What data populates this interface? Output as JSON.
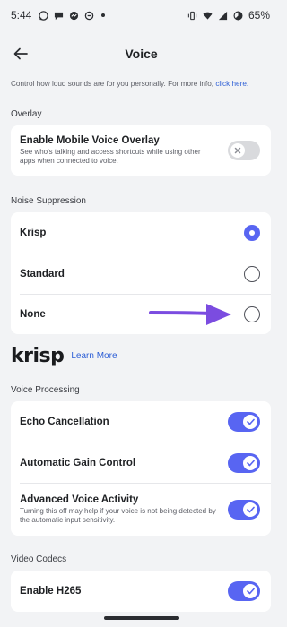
{
  "status_bar": {
    "time": "5:44",
    "battery": "65%"
  },
  "header": {
    "title": "Voice"
  },
  "info": {
    "text": "Control how loud sounds are for you personally. For more info,",
    "link": "click here."
  },
  "overlay": {
    "section_label": "Overlay",
    "title": "Enable Mobile Voice Overlay",
    "description": "See who's talking and access shortcuts while using other apps when connected to voice.",
    "enabled": false
  },
  "noise_suppression": {
    "section_label": "Noise Suppression",
    "options": [
      {
        "label": "Krisp",
        "selected": true
      },
      {
        "label": "Standard",
        "selected": false
      },
      {
        "label": "None",
        "selected": false
      }
    ]
  },
  "krisp": {
    "logo_text": "krisp",
    "learn_more": "Learn More"
  },
  "voice_processing": {
    "section_label": "Voice Processing",
    "echo_cancellation": {
      "label": "Echo Cancellation",
      "enabled": true
    },
    "gain_control": {
      "label": "Automatic Gain Control",
      "enabled": true
    },
    "voice_activity": {
      "label": "Advanced Voice Activity",
      "description": "Turning this off may help if your voice is not being detected by the automatic input sensitivity.",
      "enabled": true
    }
  },
  "video_codecs": {
    "section_label": "Video Codecs",
    "h265": {
      "label": "Enable H265",
      "enabled": true
    }
  },
  "colors": {
    "accent": "#5865f2",
    "annotation_arrow": "#7b4ce0",
    "link": "#2e5fd6",
    "background": "#f2f3f5"
  }
}
